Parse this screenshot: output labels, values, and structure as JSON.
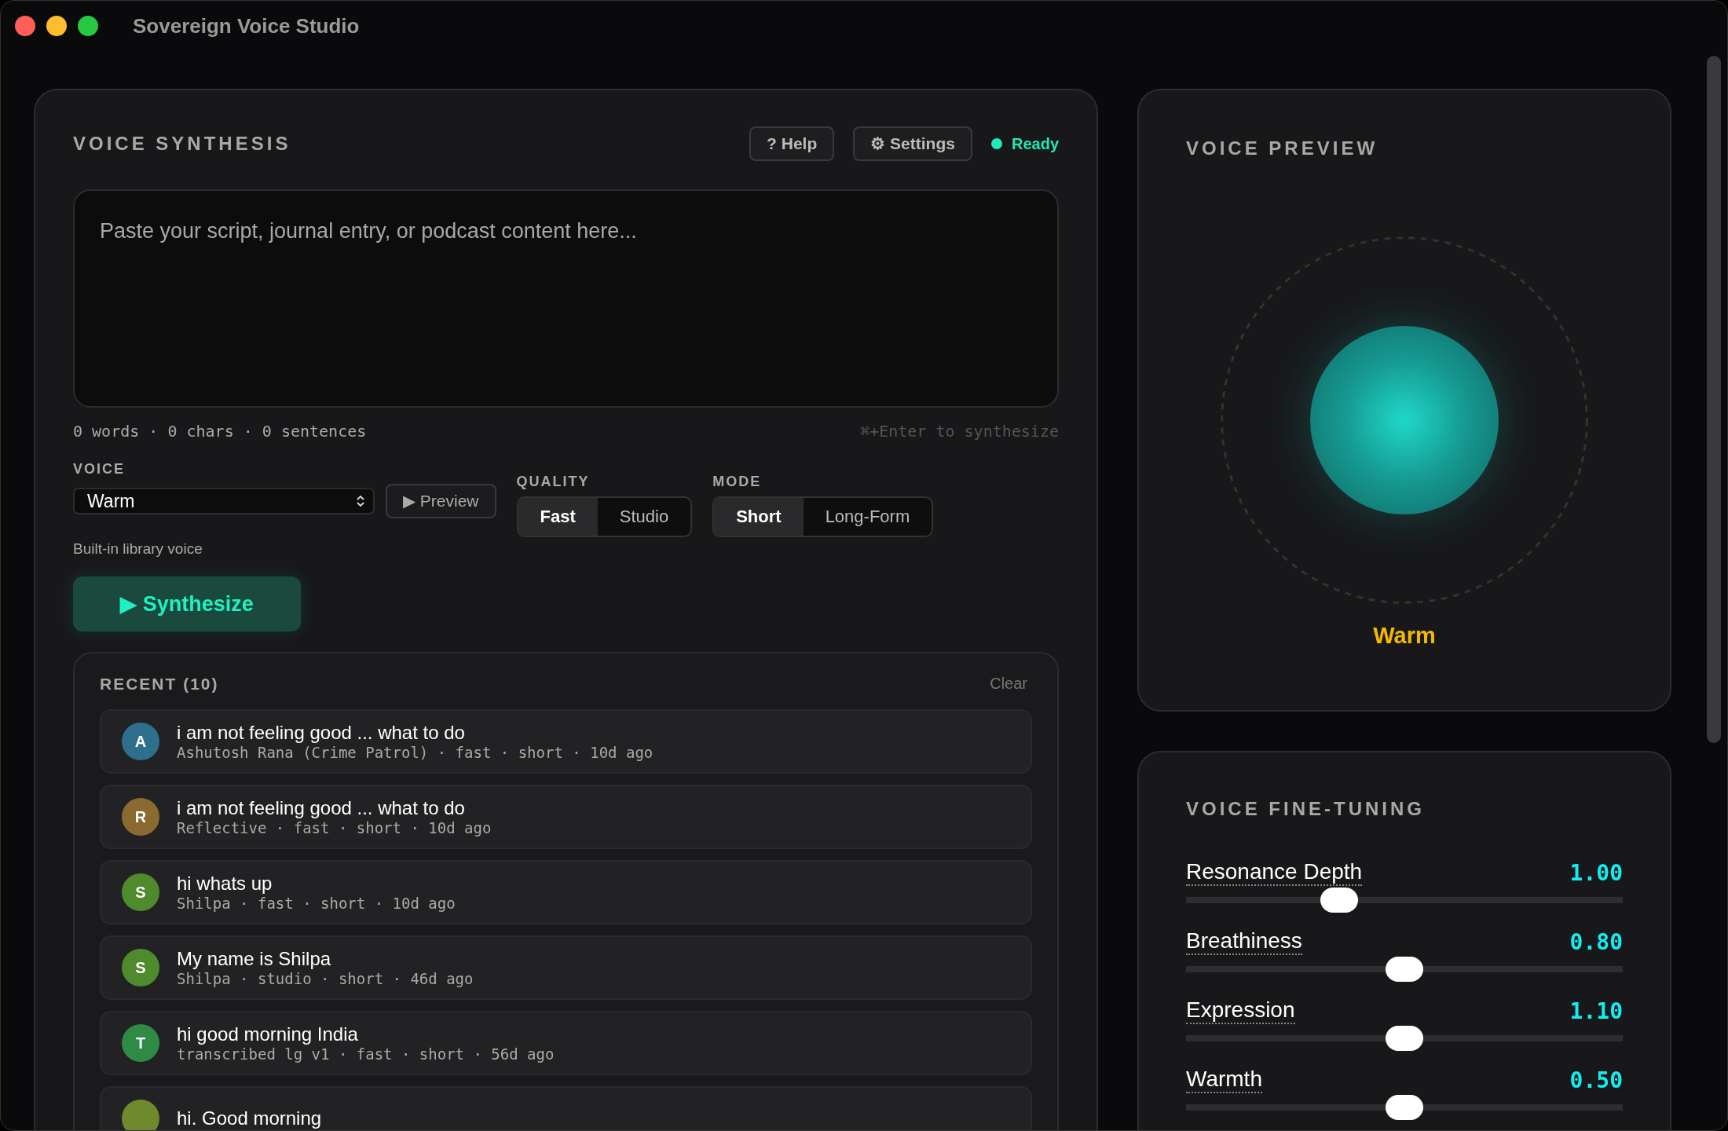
{
  "window": {
    "title": "Sovereign Voice Studio"
  },
  "synthesis": {
    "heading": "VOICE SYNTHESIS",
    "buttons": [
      {
        "label": "? Help"
      },
      {
        "label": "⚙ Settings"
      }
    ],
    "status": {
      "label": "Ready"
    },
    "editor": {
      "placeholder": "Paste your script, journal entry, or podcast content here..."
    },
    "stats": "0 words · 0 chars · 0 sentences",
    "shortcut": "⌘+Enter to synthesize",
    "voice": {
      "label": "VOICE",
      "value": "Warm",
      "hint": "Built-in library voice",
      "preview_button": "▶ Preview"
    },
    "quality": {
      "label": "QUALITY",
      "options": [
        {
          "label": "Fast",
          "selected": true
        },
        {
          "label": "Studio",
          "selected": false
        }
      ]
    },
    "mode": {
      "label": "MODE",
      "options": [
        {
          "label": "Short",
          "selected": true
        },
        {
          "label": "Long-Form",
          "selected": false
        }
      ]
    },
    "synthesize_button": "▶ Synthesize"
  },
  "recent": {
    "title": "RECENT (10)",
    "clear": "Clear",
    "items": [
      {
        "initial": "A",
        "color": "#2e6f8e",
        "title": "i am not feeling good ... what to do",
        "meta": "Ashutosh Rana (Crime Patrol) · fast · short · 10d ago"
      },
      {
        "initial": "R",
        "color": "#8a6a30",
        "title": "i am not feeling good ... what to do",
        "meta": "Reflective · fast · short · 10d ago"
      },
      {
        "initial": "S",
        "color": "#4f8a2c",
        "title": "hi whats up",
        "meta": "Shilpa · fast · short · 10d ago"
      },
      {
        "initial": "S",
        "color": "#4f8a2c",
        "title": "My name is Shilpa",
        "meta": "Shilpa · studio · short · 46d ago"
      },
      {
        "initial": "T",
        "color": "#2e8a45",
        "title": "hi good morning India",
        "meta": "transcribed lg v1 · fast · short · 56d ago"
      },
      {
        "color": "#6f8a2c",
        "title": "hi. Good morning"
      }
    ]
  },
  "preview": {
    "heading": "VOICE PREVIEW",
    "voice_name": "Warm"
  },
  "tuning": {
    "heading": "VOICE FINE-TUNING",
    "sliders": [
      {
        "label": "Resonance Depth",
        "reading": "1.00",
        "level": 0.35
      },
      {
        "label": "Breathiness",
        "reading": "0.80",
        "level": 0.5
      },
      {
        "label": "Expression",
        "reading": "1.10",
        "level": 0.5
      },
      {
        "label": "Warmth",
        "reading": "0.50",
        "level": 0.5
      }
    ]
  }
}
